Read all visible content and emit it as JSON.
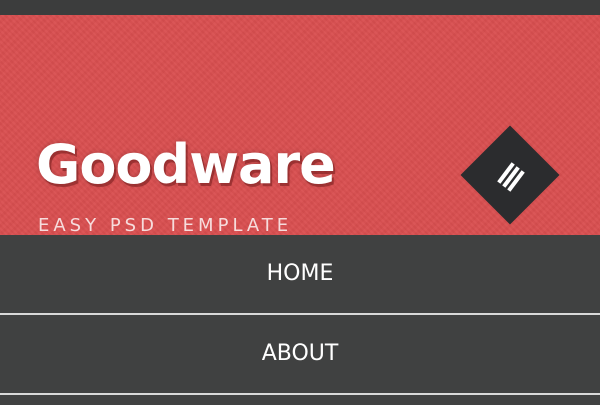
{
  "brand": {
    "title": "Goodware",
    "tagline": "EASY PSD TEMPLATE"
  },
  "menu_toggle": {
    "icon": "hamburger-icon"
  },
  "nav": {
    "items": [
      {
        "label": "HOME"
      },
      {
        "label": "ABOUT"
      }
    ]
  },
  "colors": {
    "header_bg": "#d94f50",
    "nav_bg": "#404141",
    "toggle_bg": "#2b2c2e",
    "divider": "#d9d9d9",
    "text": "#ffffff"
  }
}
